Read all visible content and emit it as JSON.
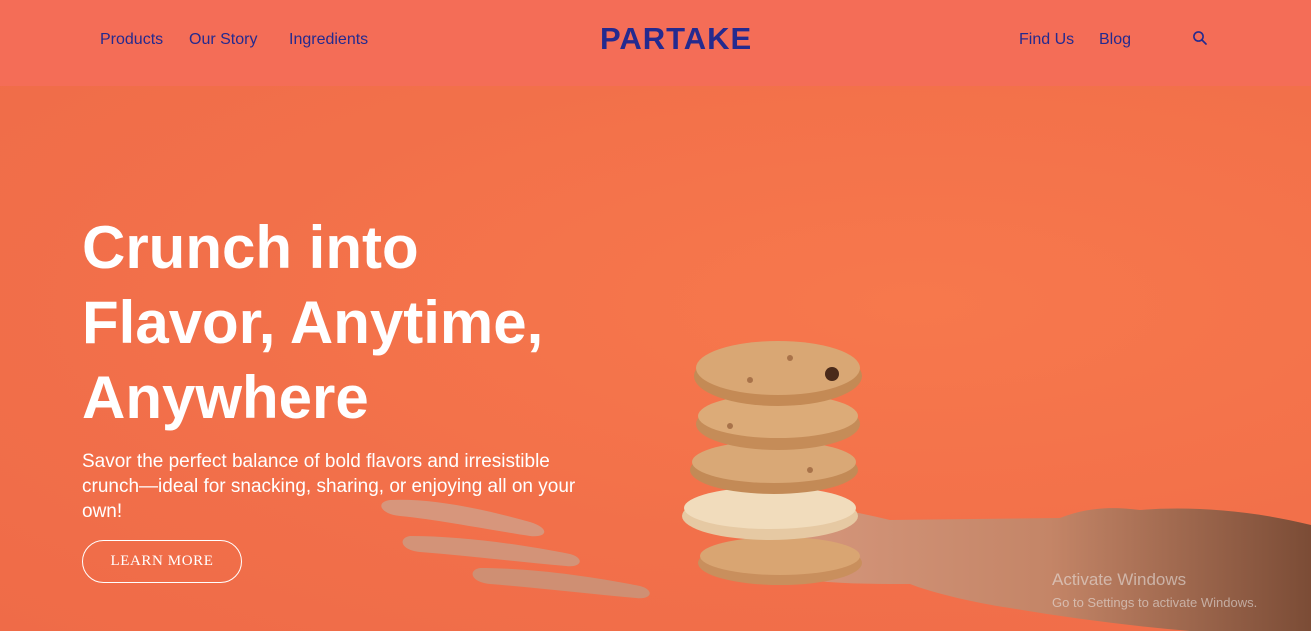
{
  "brand": {
    "logo": "PARTAKE",
    "color": "#242a8f"
  },
  "nav": {
    "left": [
      "Products",
      "Our Story",
      "Ingredients"
    ],
    "right": [
      "Find Us",
      "Blog"
    ],
    "search_icon": "search-icon"
  },
  "hero": {
    "headline_lines": [
      "Crunch into",
      "Flavor, Anytime,",
      "Anywhere"
    ],
    "subtext": "Savor the perfect balance of bold flavors and irresistible crunch—ideal for snacking, sharing, or enjoying all on your own!",
    "cta_label": "LEARN MORE",
    "image": "hand-holding-cookie-stack",
    "background_color": "#f27248"
  },
  "os_watermark": {
    "title": "Activate Windows",
    "subtitle": "Go to Settings to activate Windows."
  },
  "colors": {
    "header_bg": "#f46d57",
    "hero_bg": "#f27248",
    "nav_text": "#242a8f",
    "hero_text": "#ffffff"
  }
}
